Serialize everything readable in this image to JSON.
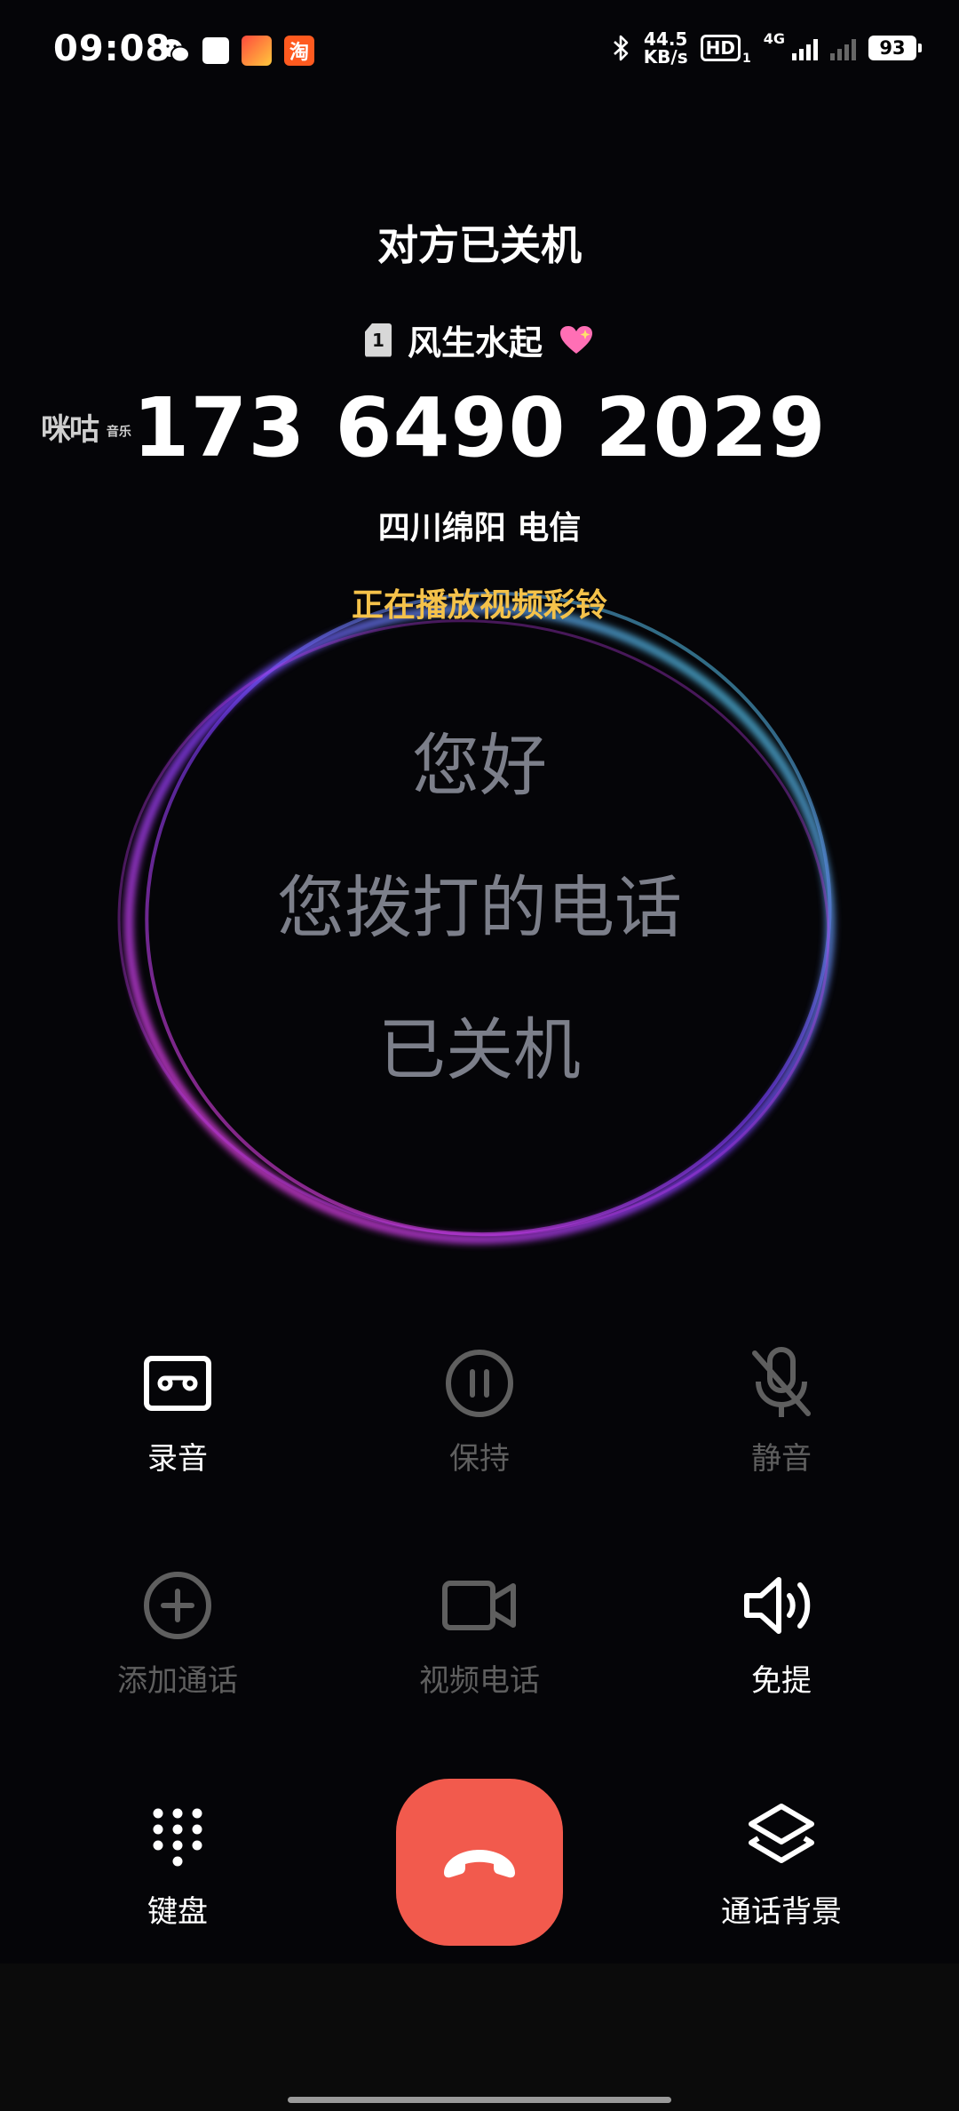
{
  "status_bar": {
    "time": "09:08",
    "net_speed_value": "44.5",
    "net_speed_unit": "KB/s",
    "hd_label": "HD",
    "hd_sim": "1",
    "network": "4G",
    "battery": "93"
  },
  "call": {
    "status": "对方已关机",
    "sim_slot": "1",
    "contact_name": "风生水起",
    "number": "173 6490 2029",
    "location": "四川绵阳  电信",
    "ringback_notice": "正在播放视频彩铃",
    "provider_logo": "咪咕",
    "provider_logo_sub": "音乐"
  },
  "video_ringback": {
    "lines": [
      "您好",
      "您拨打的电话",
      "已关机"
    ]
  },
  "controls": {
    "record": "录音",
    "hold": "保持",
    "mute": "静音",
    "add_call": "添加通话",
    "video_call": "视频电话",
    "speaker": "免提",
    "keypad": "键盘",
    "call_background": "通话背景"
  },
  "colors": {
    "hangup": "#f25a4d",
    "ringback_text": "#f5c24a",
    "disabled": "#5f5f5f"
  }
}
